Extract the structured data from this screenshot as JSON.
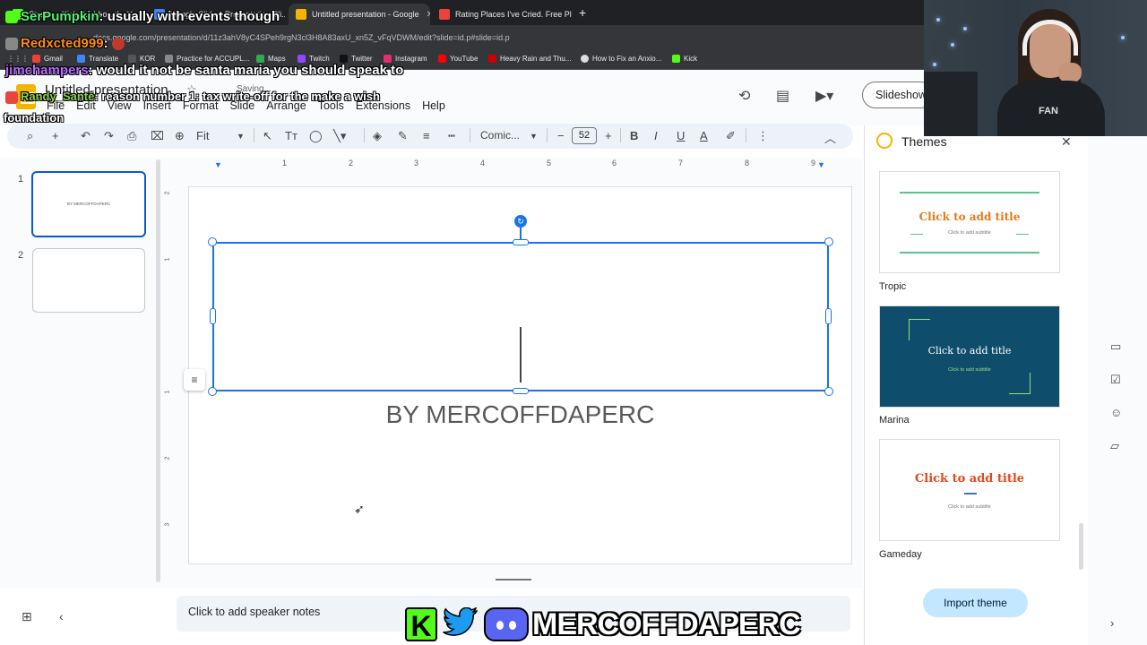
{
  "browser": {
    "tabs": [
      {
        "label": "Stream - Kick Dashboard"
      },
      {
        "label": "Google Slides: Presentation Sli..."
      },
      {
        "label": "Untitled presentation - Google"
      },
      {
        "label": "Rating Places I've Cried. Free Pl"
      }
    ],
    "url": "docs.google.com/presentation/d/11z3ahV8yC4SPeh9rgN3cl3H8A83axU_xn5Z_vFqVDWM/edit?slide=id.p#slide=id.p",
    "bookmarks": [
      "Gmail",
      "Translate",
      "KOR",
      "Practice for ACCUPL...",
      "Maps",
      "Twitch",
      "Twitter",
      "Instagram",
      "YouTube",
      "Heavy Rain and Thu...",
      "How to Fix an Anxio...",
      "Kick"
    ]
  },
  "app": {
    "title": "Untitled presentation",
    "saving": "Saving...",
    "menu": [
      "File",
      "Edit",
      "View",
      "Insert",
      "Format",
      "Slide",
      "Arrange",
      "Tools",
      "Extensions",
      "Help"
    ],
    "slideshow": "Slideshow"
  },
  "toolbar": {
    "zoom": "Fit",
    "font": "Comic...",
    "font_size": "52"
  },
  "ruler": {
    "top": [
      "1",
      "2",
      "3",
      "4",
      "5",
      "6",
      "7",
      "8",
      "9"
    ],
    "left": [
      "2",
      "1",
      "1",
      "2",
      "3"
    ]
  },
  "slides": [
    {
      "number": "1",
      "text": "BY MERCOFFDAPERC"
    },
    {
      "number": "2",
      "text": ""
    }
  ],
  "canvas": {
    "subtitle": "BY MERCOFFDAPERC"
  },
  "notes": {
    "placeholder": "Click to add speaker notes"
  },
  "themes": {
    "heading": "Themes",
    "items": [
      {
        "name": "Tropic",
        "title": "Click to add title",
        "subtitle": "Click to add subtitle",
        "bg": "#ffffff",
        "title_color": "#e07b1a",
        "sub_color": "#777777"
      },
      {
        "name": "Marina",
        "title": "Click to add title",
        "subtitle": "Click to add subtitle",
        "bg": "#0e4d6b",
        "title_color": "#ffffff",
        "sub_color": "#9be07a"
      },
      {
        "name": "Gameday",
        "title": "Click to add title",
        "subtitle": "Click to add subtitle",
        "bg": "#ffffff",
        "title_color": "#e5481c",
        "sub_color": "#777777"
      }
    ],
    "import_label": "Import theme"
  },
  "overlay": {
    "chat": [
      {
        "user": "SerPumpkin",
        "color": "#59f07a",
        "message": ": usually with events though"
      },
      {
        "user": "Redxcted999",
        "color": "#ff8c1a",
        "message": ":"
      },
      {
        "user": "jimchampers",
        "color": "#b86cff",
        "message": ": would it not be santa maria you should speak to"
      },
      {
        "user": "Randy_Santé",
        "color": "#8fd14f",
        "message": ": reason number 1: tax write-off for the make a wish"
      },
      {
        "user": "",
        "color": "#ffffff",
        "message": "foundation"
      }
    ],
    "hoodie_text": "FAN",
    "brand_name": "MERCOFFDAPERC",
    "brand_k": "K"
  }
}
